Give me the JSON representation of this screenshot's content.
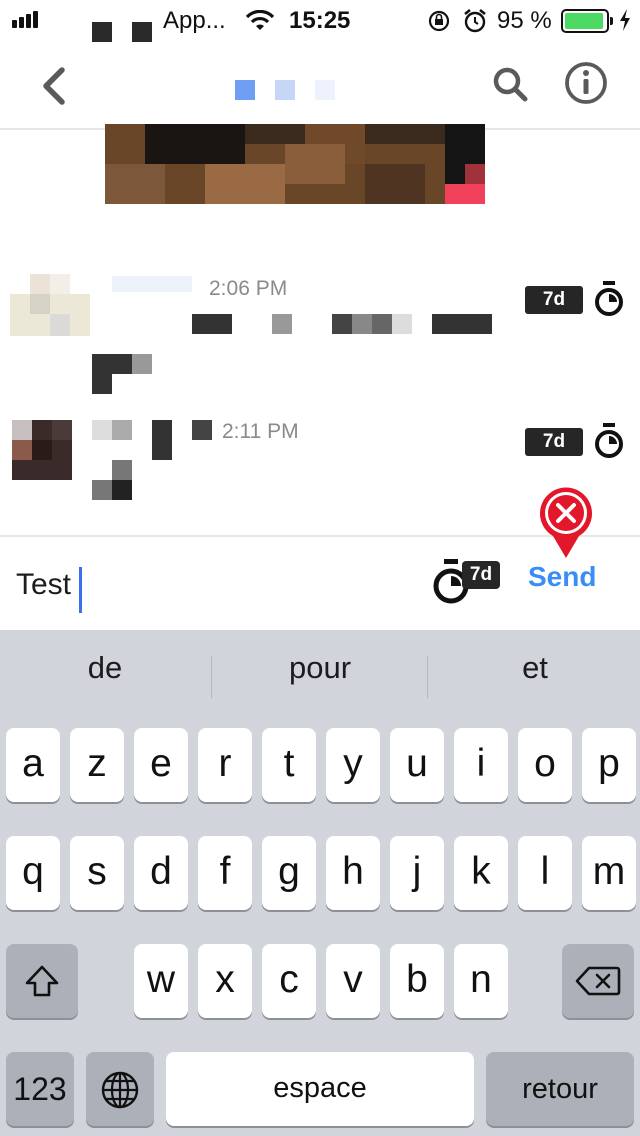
{
  "status_bar": {
    "carrier": "App...",
    "time": "15:25",
    "battery_percent": "95 %",
    "battery_level": 0.95,
    "icons": [
      "signal-icon",
      "wifi-icon",
      "orientation-lock-icon",
      "alarm-icon",
      "battery-icon",
      "charging-icon"
    ]
  },
  "nav": {
    "icons": [
      "back-chevron-icon",
      "search-icon",
      "info-icon"
    ]
  },
  "messages": [
    {
      "time": "2:06 PM",
      "expiry": "7d",
      "icon": "timer-icon"
    },
    {
      "time": "2:11 PM",
      "expiry": "7d",
      "icon": "timer-icon"
    }
  ],
  "composer": {
    "text": "Test",
    "timer_label": "7d",
    "send_label": "Send",
    "error_icon": "error-x-icon"
  },
  "keyboard": {
    "suggestions": [
      "de",
      "pour",
      "et"
    ],
    "row1": [
      "a",
      "z",
      "e",
      "r",
      "t",
      "y",
      "u",
      "i",
      "o",
      "p"
    ],
    "row2": [
      "q",
      "s",
      "d",
      "f",
      "g",
      "h",
      "j",
      "k",
      "l",
      "m"
    ],
    "row3": [
      "w",
      "x",
      "c",
      "v",
      "b",
      "n"
    ],
    "numbers_label": "123",
    "space_label": "espace",
    "return_label": "retour",
    "icons": [
      "shift-icon",
      "backspace-icon",
      "globe-icon"
    ]
  },
  "colors": {
    "accent": "#3b8df6",
    "badge": "#262626",
    "error": "#e3172a",
    "battery": "#4cd964"
  }
}
